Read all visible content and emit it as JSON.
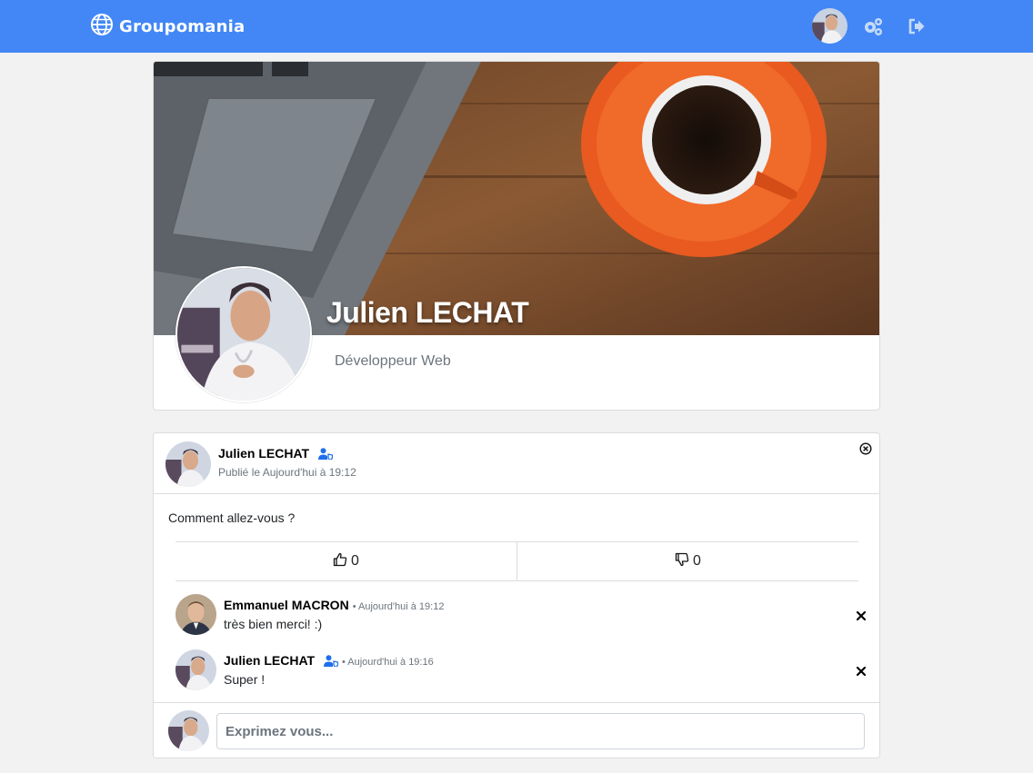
{
  "app": {
    "brand": "Groupomania"
  },
  "profile": {
    "name": "Julien LECHAT",
    "job": "Développeur Web"
  },
  "post": {
    "author": "Julien LECHAT",
    "date": "Publié le Aujourd'hui à 19:12",
    "content": "Comment allez-vous ?",
    "likes": "0",
    "dislikes": "0",
    "comments": [
      {
        "author": "Emmanuel MACRON",
        "date": "• Aujourd'hui à 19:12",
        "text": "très bien merci! :)",
        "admin": false
      },
      {
        "author": "Julien LECHAT",
        "date": "• Aujourd'hui à 19:16",
        "text": "Super !",
        "admin": true
      }
    ]
  },
  "composer": {
    "placeholder": "Exprimez vous..."
  },
  "colors": {
    "primary": "#4287f5",
    "admin_badge": "#1f6feb",
    "accent_orange": "#e85a1f"
  },
  "icons": [
    "globe-icon",
    "cog-icon",
    "logout-icon",
    "user-shield-icon",
    "thumbs-up-icon",
    "thumbs-down-icon",
    "close-circle-icon",
    "close-icon"
  ]
}
